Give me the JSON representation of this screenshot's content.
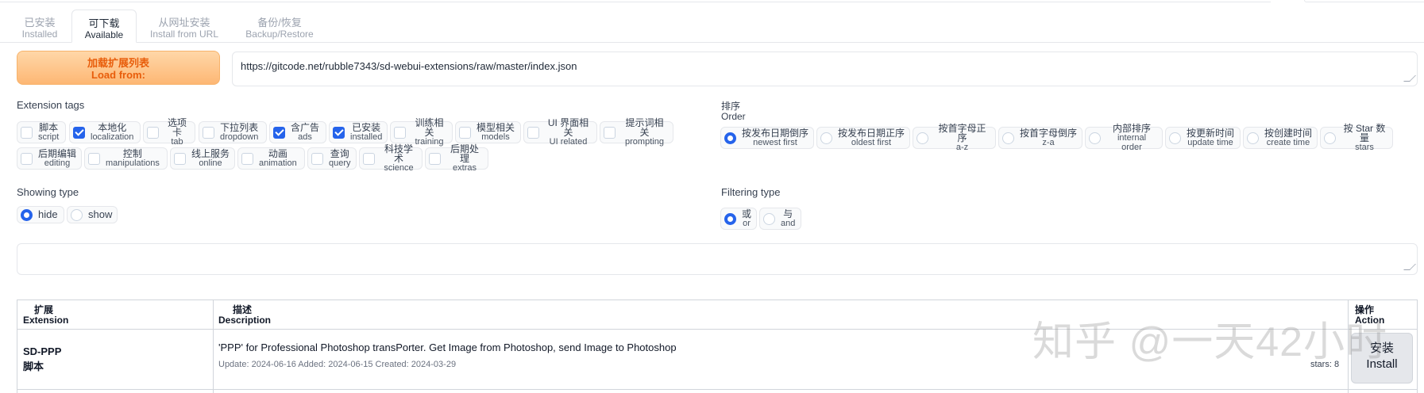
{
  "tabs": [
    {
      "zh": "已安装",
      "en": "Installed"
    },
    {
      "zh": "可下载",
      "en": "Available"
    },
    {
      "zh": "从网址安装",
      "en": "Install from URL"
    },
    {
      "zh": "备份/恢复",
      "en": "Backup/Restore"
    }
  ],
  "load_button": {
    "zh": "加载扩展列表",
    "en": "Load from:"
  },
  "url_value": "https://gitcode.net/rubble7343/sd-webui-extensions/raw/master/index.json",
  "extension_tags": {
    "label": "Extension tags",
    "items": [
      {
        "zh": "脚本",
        "en": "script",
        "checked": false
      },
      {
        "zh": "本地化",
        "en": "localization",
        "checked": true
      },
      {
        "zh": "选项卡",
        "en": "tab",
        "checked": false
      },
      {
        "zh": "下拉列表",
        "en": "dropdown",
        "checked": false
      },
      {
        "zh": "含广告",
        "en": "ads",
        "checked": true
      },
      {
        "zh": "已安装",
        "en": "installed",
        "checked": true
      },
      {
        "zh": "训练相关",
        "en": "training",
        "checked": false
      },
      {
        "zh": "模型相关",
        "en": "models",
        "checked": false
      },
      {
        "zh": "UI 界面相关",
        "en": "UI related",
        "checked": false
      },
      {
        "zh": "提示词相关",
        "en": "prompting",
        "checked": false
      },
      {
        "zh": "后期编辑",
        "en": "editing",
        "checked": false
      },
      {
        "zh": "控制",
        "en": "manipulations",
        "checked": false
      },
      {
        "zh": "线上服务",
        "en": "online",
        "checked": false
      },
      {
        "zh": "动画",
        "en": "animation",
        "checked": false
      },
      {
        "zh": "查询",
        "en": "query",
        "checked": false
      },
      {
        "zh": "科技学术",
        "en": "science",
        "checked": false
      },
      {
        "zh": "后期处理",
        "en": "extras",
        "checked": false
      }
    ]
  },
  "order": {
    "label_zh": "排序",
    "label_en": "Order",
    "items": [
      {
        "zh": "按发布日期倒序",
        "en": "newest first",
        "selected": true
      },
      {
        "zh": "按发布日期正序",
        "en": "oldest first",
        "selected": false
      },
      {
        "zh": "按首字母正序",
        "en": "a-z",
        "selected": false
      },
      {
        "zh": "按首字母倒序",
        "en": "z-a",
        "selected": false
      },
      {
        "zh": "内部排序",
        "en": "internal order",
        "selected": false
      },
      {
        "zh": "按更新时间",
        "en": "update time",
        "selected": false
      },
      {
        "zh": "按创建时间",
        "en": "create time",
        "selected": false
      },
      {
        "zh": "按 Star 数量",
        "en": "stars",
        "selected": false
      }
    ]
  },
  "showing_type": {
    "label": "Showing type",
    "items": [
      {
        "text": "hide",
        "selected": true
      },
      {
        "text": "show",
        "selected": false
      }
    ]
  },
  "filtering_type": {
    "label": "Filtering type",
    "items": [
      {
        "zh": "或",
        "en": "or",
        "selected": true
      },
      {
        "zh": "与",
        "en": "and",
        "selected": false
      }
    ]
  },
  "table": {
    "headers": {
      "extension_zh": "扩展",
      "extension_en": "Extension",
      "description_zh": "描述",
      "description_en": "Description",
      "action_zh": "操作",
      "action_en": "Action"
    },
    "rows": [
      {
        "name": "SD-PPP",
        "tag": "脚本",
        "description": "'PPP' for Professional Photoshop transPorter. Get Image from Photoshop, send Image to Photoshop",
        "dates": "Update: 2024-06-16 Added: 2024-06-15 Created: 2024-03-29",
        "stars": "stars: 8",
        "install_zh": "安装",
        "install_en": "Install"
      }
    ]
  },
  "watermark": "知乎 @一天42小时"
}
